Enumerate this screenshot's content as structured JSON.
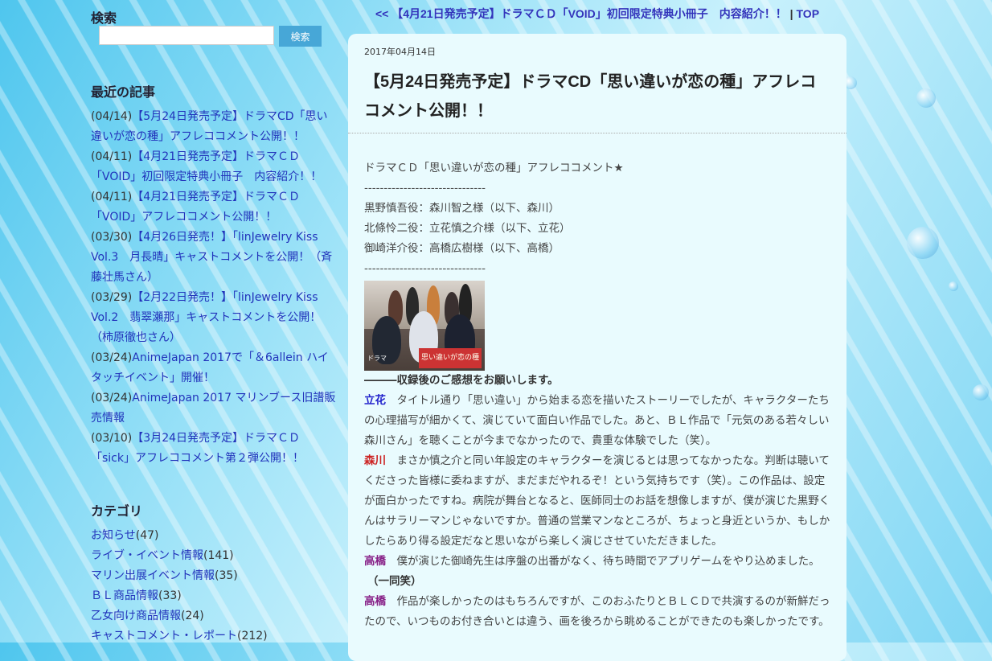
{
  "search": {
    "heading": "検索",
    "placeholder": "",
    "button_label": "検索"
  },
  "recent": {
    "heading": "最近の記事",
    "items": [
      {
        "date": "(04/14)",
        "text": "【5月24日発売予定】ドラマCD「思い違いが恋の種」アフレココメント公開！！"
      },
      {
        "date": "(04/11)",
        "text": "【4月21日発売予定】ドラマＣＤ「VOID」初回限定特典小冊子　内容紹介！！"
      },
      {
        "date": "(04/11)",
        "text": "【4月21日発売予定】ドラマＣＤ「VOID」アフレココメント公開！！"
      },
      {
        "date": "(03/30)",
        "text": "【4月26日発売！】「linJewelry Kiss Vol.3　月長晴」キャストコメントを公開！（斉藤壮馬さん）"
      },
      {
        "date": "(03/29)",
        "text": "【2月22日発売！】「linJewelry Kiss Vol.2　翡翠瀬那」キャストコメントを公開！（柿原徹也さん）"
      },
      {
        "date": "(03/24)",
        "text": "AnimeJapan 2017で「＆6allein ハイタッチイベント」開催！"
      },
      {
        "date": "(03/24)",
        "text": "AnimeJapan 2017 マリンブース旧譜販売情報"
      },
      {
        "date": "(03/10)",
        "text": "【3月24日発売予定】ドラマＣＤ「sick」アフレココメント第２弾公開！！"
      }
    ]
  },
  "categories": {
    "heading": "カテゴリ",
    "items": [
      {
        "label": "お知らせ",
        "count": "(47)"
      },
      {
        "label": "ライブ・イベント情報",
        "count": "(141)"
      },
      {
        "label": "マリン出展イベント情報",
        "count": "(35)"
      },
      {
        "label": "ＢＬ商品情報",
        "count": "(33)"
      },
      {
        "label": "乙女向け商品情報",
        "count": "(24)"
      },
      {
        "label": "キャストコメント・レポート",
        "count": "(212)"
      }
    ]
  },
  "topnav": {
    "prev": "<<  【4月21日発売予定】ドラマＣＤ「VOID」初回限定特典小冊子　内容紹介！！",
    "sep": " | ",
    "top": "TOP"
  },
  "article": {
    "date": "2017年04月14日",
    "title": "【5月24日発売予定】ドラマCD「思い違いが恋の種」アフレココメント公開！！",
    "intro": "ドラマＣＤ「思い違いが恋の種」アフレココメント★",
    "divider": "-------------------------------",
    "cast": [
      "黒野慎吾役：森川智之様（以下、森川）",
      "北條怜二役：立花慎之介様（以下、立花）",
      "御崎洋介役：高橋広樹様（以下、高橋）"
    ],
    "photo_caption": "思い違いが恋の種",
    "photo_label": "ドラマ",
    "question": "―――収録後のご感想をお願いします。",
    "comments": [
      {
        "speaker": "立花",
        "color": "blue",
        "text": "タイトル通り「思い違い」から始まる恋を描いたストーリーでしたが、キャラクターたちの心理描写が細かくて、演じていて面白い作品でした。あと、ＢＬ作品で「元気のある若々しい森川さん」を聴くことが今までなかったので、貴重な体験でした（笑）。"
      },
      {
        "speaker": "森川",
        "color": "red",
        "text": "まさか慎之介と同い年設定のキャラクターを演じるとは思ってなかったな。判断は聴いてくださった皆様に委ねますが、まだまだやれるぞ！という気持ちです（笑）。この作品は、設定が面白かったですね。病院が舞台となると、医師同士のお話を想像しますが、僕が演じた黒野くんはサラリーマンじゃないですか。普通の営業マンなところが、ちょっと身近というか、もしかしたらあり得る設定だなと思いながら楽しく演じさせていただきました。"
      },
      {
        "speaker": "高橋",
        "color": "purple",
        "text": "僕が演じた御崎先生は序盤の出番がなく、待ち時間でアプリゲームをやり込めました。"
      }
    ],
    "all_laugh": "（一同笑）",
    "last_comment": {
      "speaker": "高橋",
      "text": "作品が楽しかったのはもちろんですが、このおふたりとＢＬＣＤで共演するのが新鮮だったので、いつものお付き合いとは違う、画を後ろから眺めることができたのも楽しかったです。"
    }
  }
}
